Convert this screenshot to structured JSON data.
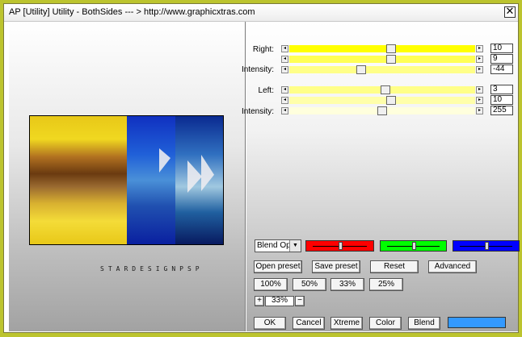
{
  "window": {
    "title": "AP [Utility]  Utility - BothSides    --- > http://www.graphicxtras.com",
    "close_glyph": "✕"
  },
  "preview": {
    "watermark": "STARDESIGNPSP"
  },
  "right_group": {
    "label_right": "Right:",
    "label_intensity": "Intensity:",
    "sliders": [
      {
        "value": "10",
        "fraction": 0.55,
        "track_color": "#ffff00"
      },
      {
        "value": "9",
        "fraction": 0.55,
        "track_color": "#ffff55"
      },
      {
        "value": "-44",
        "fraction": 0.38,
        "track_color": "#ffff88"
      }
    ]
  },
  "left_group": {
    "label_left": "Left:",
    "label_intensity": "Intensity:",
    "sliders": [
      {
        "value": "3",
        "fraction": 0.52,
        "track_color": "#ffff88"
      },
      {
        "value": "10",
        "fraction": 0.55,
        "track_color": "#ffffaa"
      },
      {
        "value": "255",
        "fraction": 0.5,
        "track_color": "#ffffdd"
      }
    ]
  },
  "blend_select": {
    "value": "Blend Opti",
    "arrow": "▼"
  },
  "color_sliders": [
    {
      "color": "#ff0000",
      "fraction": 0.5
    },
    {
      "color": "#00ff00",
      "fraction": 0.5
    },
    {
      "color": "#0000ff",
      "fraction": 0.5
    }
  ],
  "buttons": {
    "open_preset": "Open preset",
    "save_preset": "Save preset",
    "reset": "Reset",
    "advanced": "Advanced",
    "z100": "100%",
    "z50": "50%",
    "z33": "33%",
    "z25": "25%",
    "ok": "OK",
    "cancel": "Cancel",
    "xtreme": "Xtreme",
    "color": "Color",
    "blend": "Blend"
  },
  "zoom": {
    "plus": "+",
    "value": "33%",
    "minus": "−"
  },
  "swatch_color": "#3399ff",
  "slider_arrows": {
    "left": "◂",
    "right": "▸"
  }
}
